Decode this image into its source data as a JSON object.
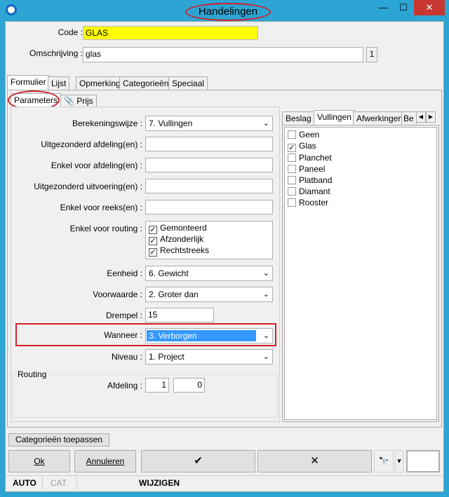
{
  "window": {
    "title": "Handelingen",
    "min": "—",
    "max": "☐",
    "close": "✕"
  },
  "form": {
    "code_label": "Code :",
    "code_value": "GLAS",
    "omschrijving_label": "Omschrijving :",
    "omschrijving_value": "glas",
    "omschrijving_count": "1"
  },
  "tabs": [
    "Formulier",
    "Lijst",
    "Opmerking",
    "Categorieën",
    "Speciaal"
  ],
  "subtabs": [
    "Parameters",
    "Prijs"
  ],
  "params": {
    "berekeningswijze_label": "Berekeningswijze :",
    "berekeningswijze_value": "7.  Vullingen",
    "uitgezonderd_afdeling_label": "Uitgezonderd afdeling(en) :",
    "enkel_afdeling_label": "Enkel voor afdeling(en) :",
    "uitgezonderd_uitvoering_label": "Uitgezonderd uitvoering(en) :",
    "enkel_reeks_label": "Enkel voor reeks(en) :",
    "routing_label": "Enkel voor routing :",
    "routing_options": [
      "Gemonteerd",
      "Afzonderlijk",
      "Rechtstreeks"
    ],
    "eenheid_label": "Eenheid :",
    "eenheid_value": "6.  Gewicht",
    "voorwaarde_label": "Voorwaarde :",
    "voorwaarde_value": "2.  Groter dan",
    "drempel_label": "Drempel :",
    "drempel_value": "15",
    "wanneer_label": "Wanneer :",
    "wanneer_value": "3.  Verborgen",
    "niveau_label": "Niveau :",
    "niveau_value": "1.  Project"
  },
  "routing_group": {
    "title": "Routing",
    "afdeling_label": "Afdeling :",
    "afdeling_val1": "1",
    "afdeling_val2": "0"
  },
  "right_tabs": [
    "Beslag",
    "Vullingen",
    "Afwerkingen",
    "Be"
  ],
  "vullingen": [
    {
      "label": "Geen",
      "checked": false
    },
    {
      "label": "Glas",
      "checked": true
    },
    {
      "label": "Planchet",
      "checked": false
    },
    {
      "label": "Paneel",
      "checked": false
    },
    {
      "label": "Platband",
      "checked": false
    },
    {
      "label": "Diamant",
      "checked": false
    },
    {
      "label": "Rooster",
      "checked": false
    }
  ],
  "buttons": {
    "categorieen_toepassen": "Categorieën toepassen",
    "ok": "Ok",
    "annuleren": "Annuleren",
    "confirm": "✔",
    "cancel": "✕",
    "binoculars": "🔭",
    "dropdown": "▾"
  },
  "statusbar": {
    "auto": "AUTO",
    "cat": "CAT",
    "mode": "WIJZIGEN"
  },
  "colors": {
    "highlight": "#ffff00",
    "selection": "#3399ff",
    "annotation": "#d0202a"
  }
}
